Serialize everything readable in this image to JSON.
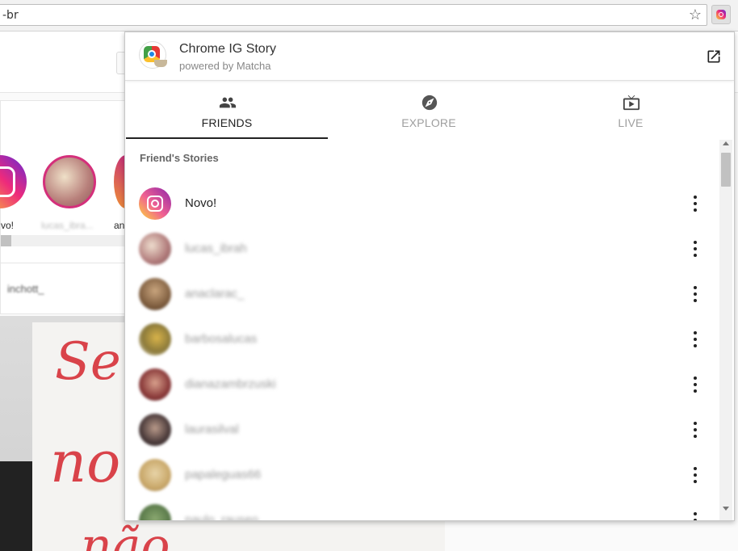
{
  "browser": {
    "url_fragment": "-br",
    "bookmark_icon": "star-icon",
    "extension_icon": "instagram-icon"
  },
  "background_page": {
    "stories": [
      {
        "label": "vo!"
      },
      {
        "label": "lucas_ibra..."
      },
      {
        "label": "an"
      }
    ],
    "post_username": "inchott_",
    "handwriting": [
      "Se",
      "no",
      "não"
    ]
  },
  "popup": {
    "title": "Chrome IG Story",
    "subtitle": "powered by Matcha",
    "tabs": [
      {
        "label": "FRIENDS",
        "icon": "people-icon",
        "active": true
      },
      {
        "label": "EXPLORE",
        "icon": "compass-icon",
        "active": false
      },
      {
        "label": "LIVE",
        "icon": "live-tv-icon",
        "active": false
      }
    ],
    "section_title": "Friend's Stories",
    "stories": [
      {
        "username": "Novo!",
        "blurred": false
      },
      {
        "username": "lucas_ibrah",
        "blurred": true
      },
      {
        "username": "anaclarac_",
        "blurred": true
      },
      {
        "username": "barbosalucas",
        "blurred": true
      },
      {
        "username": "dianazambrzuski",
        "blurred": true
      },
      {
        "username": "laurasilval",
        "blurred": true
      },
      {
        "username": "papaleguas66",
        "blurred": true
      },
      {
        "username": "paulo_rauseo",
        "blurred": true
      }
    ]
  },
  "colors": {
    "accent": "#222222",
    "inactive_tab": "#9e9e9e",
    "instagram_gradient": [
      "#fdd835",
      "#f06292",
      "#8e24aa"
    ]
  }
}
